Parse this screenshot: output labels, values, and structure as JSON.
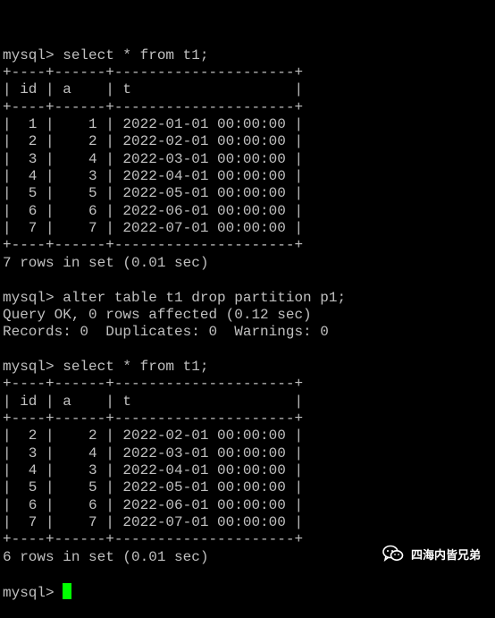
{
  "terminal": {
    "lines": [
      "mysql> select * from t1;",
      "+----+------+---------------------+",
      "| id | a    | t                   |",
      "+----+------+---------------------+",
      "|  1 |    1 | 2022-01-01 00:00:00 |",
      "|  2 |    2 | 2022-02-01 00:00:00 |",
      "|  3 |    4 | 2022-03-01 00:00:00 |",
      "|  4 |    3 | 2022-04-01 00:00:00 |",
      "|  5 |    5 | 2022-05-01 00:00:00 |",
      "|  6 |    6 | 2022-06-01 00:00:00 |",
      "|  7 |    7 | 2022-07-01 00:00:00 |",
      "+----+------+---------------------+",
      "7 rows in set (0.01 sec)",
      "",
      "mysql> alter table t1 drop partition p1;",
      "Query OK, 0 rows affected (0.12 sec)",
      "Records: 0  Duplicates: 0  Warnings: 0",
      "",
      "mysql> select * from t1;",
      "+----+------+---------------------+",
      "| id | a    | t                   |",
      "+----+------+---------------------+",
      "|  2 |    2 | 2022-02-01 00:00:00 |",
      "|  3 |    4 | 2022-03-01 00:00:00 |",
      "|  4 |    3 | 2022-04-01 00:00:00 |",
      "|  5 |    5 | 2022-05-01 00:00:00 |",
      "|  6 |    6 | 2022-06-01 00:00:00 |",
      "|  7 |    7 | 2022-07-01 00:00:00 |",
      "+----+------+---------------------+",
      "6 rows in set (0.01 sec)",
      ""
    ],
    "prompt": "mysql> ",
    "colors": {
      "background": "#000000",
      "text": "#c0c0c0",
      "cursor": "#00ff00"
    }
  },
  "watermark": {
    "text": "四海内皆兄弟",
    "icon": "wechat-icon"
  }
}
